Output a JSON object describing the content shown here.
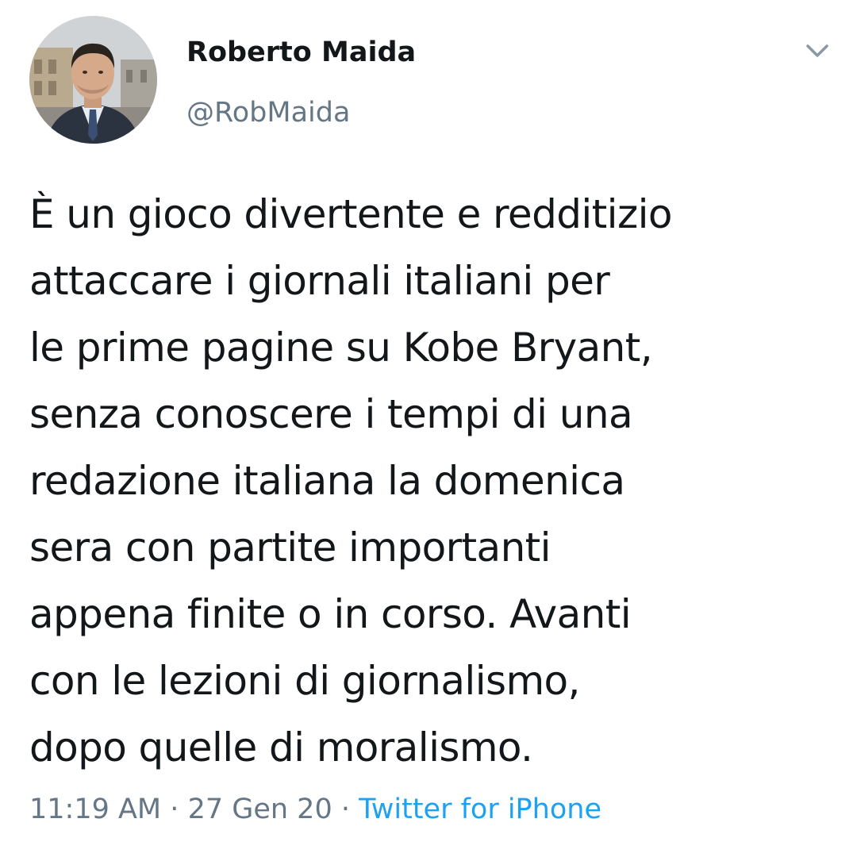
{
  "author": {
    "display_name": "Roberto Maida",
    "handle": "@RobMaida",
    "avatar_icon": "profile-photo"
  },
  "menu": {
    "icon": "chevron-down-icon"
  },
  "tweet": {
    "lines": [
      "È un gioco divertente e redditizio",
      "attaccare i giornali italiani per",
      "le prime pagine su Kobe Bryant,",
      "senza conoscere i tempi di una",
      "redazione italiana la domenica",
      "sera con partite importanti",
      "appena finite o in corso. Avanti",
      "con le lezioni di giornalismo,",
      "dopo quelle di moralismo."
    ]
  },
  "meta": {
    "time": "11:19 AM",
    "separator": "·",
    "date": "27 Gen 20",
    "source": "Twitter for iPhone"
  },
  "colors": {
    "text": "#14171a",
    "secondary": "#657786",
    "link": "#1da1f2",
    "background": "#ffffff"
  }
}
